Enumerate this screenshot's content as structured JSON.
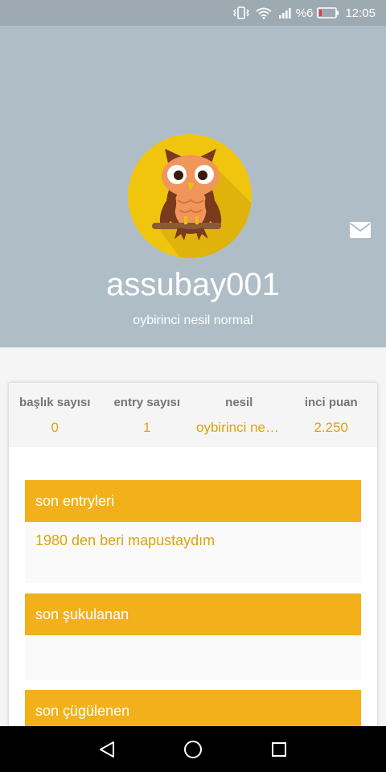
{
  "status_bar": {
    "battery_percent": "%6",
    "time": "12:05",
    "icons": [
      "vibrate-icon",
      "wifi-icon",
      "signal-icon",
      "battery-icon"
    ]
  },
  "profile": {
    "username": "assubay001",
    "subtitle": "oybirinci nesil normal",
    "avatar_icon": "owl-avatar-icon",
    "message_icon": "mail-icon"
  },
  "stats": [
    {
      "label": "başlık sayısı",
      "value": "0"
    },
    {
      "label": "entry sayısı",
      "value": "1"
    },
    {
      "label": "nesil",
      "value": "oybirinci nesil normal"
    },
    {
      "label": "inci puan",
      "value": "2.250"
    }
  ],
  "sections": {
    "entries": {
      "title": "son entryleri",
      "items": [
        "1980 den beri mapustaydım"
      ]
    },
    "liked": {
      "title": "son şukulanan"
    },
    "disliked": {
      "title": "son çügülenen"
    }
  },
  "nav": {
    "icons": [
      "back-icon",
      "home-icon",
      "recents-icon"
    ]
  },
  "colors": {
    "header_bg": "#afbec6",
    "accent": "#f2b11b",
    "value_text": "#dba410",
    "avatar_bg": "#f1c50e"
  }
}
